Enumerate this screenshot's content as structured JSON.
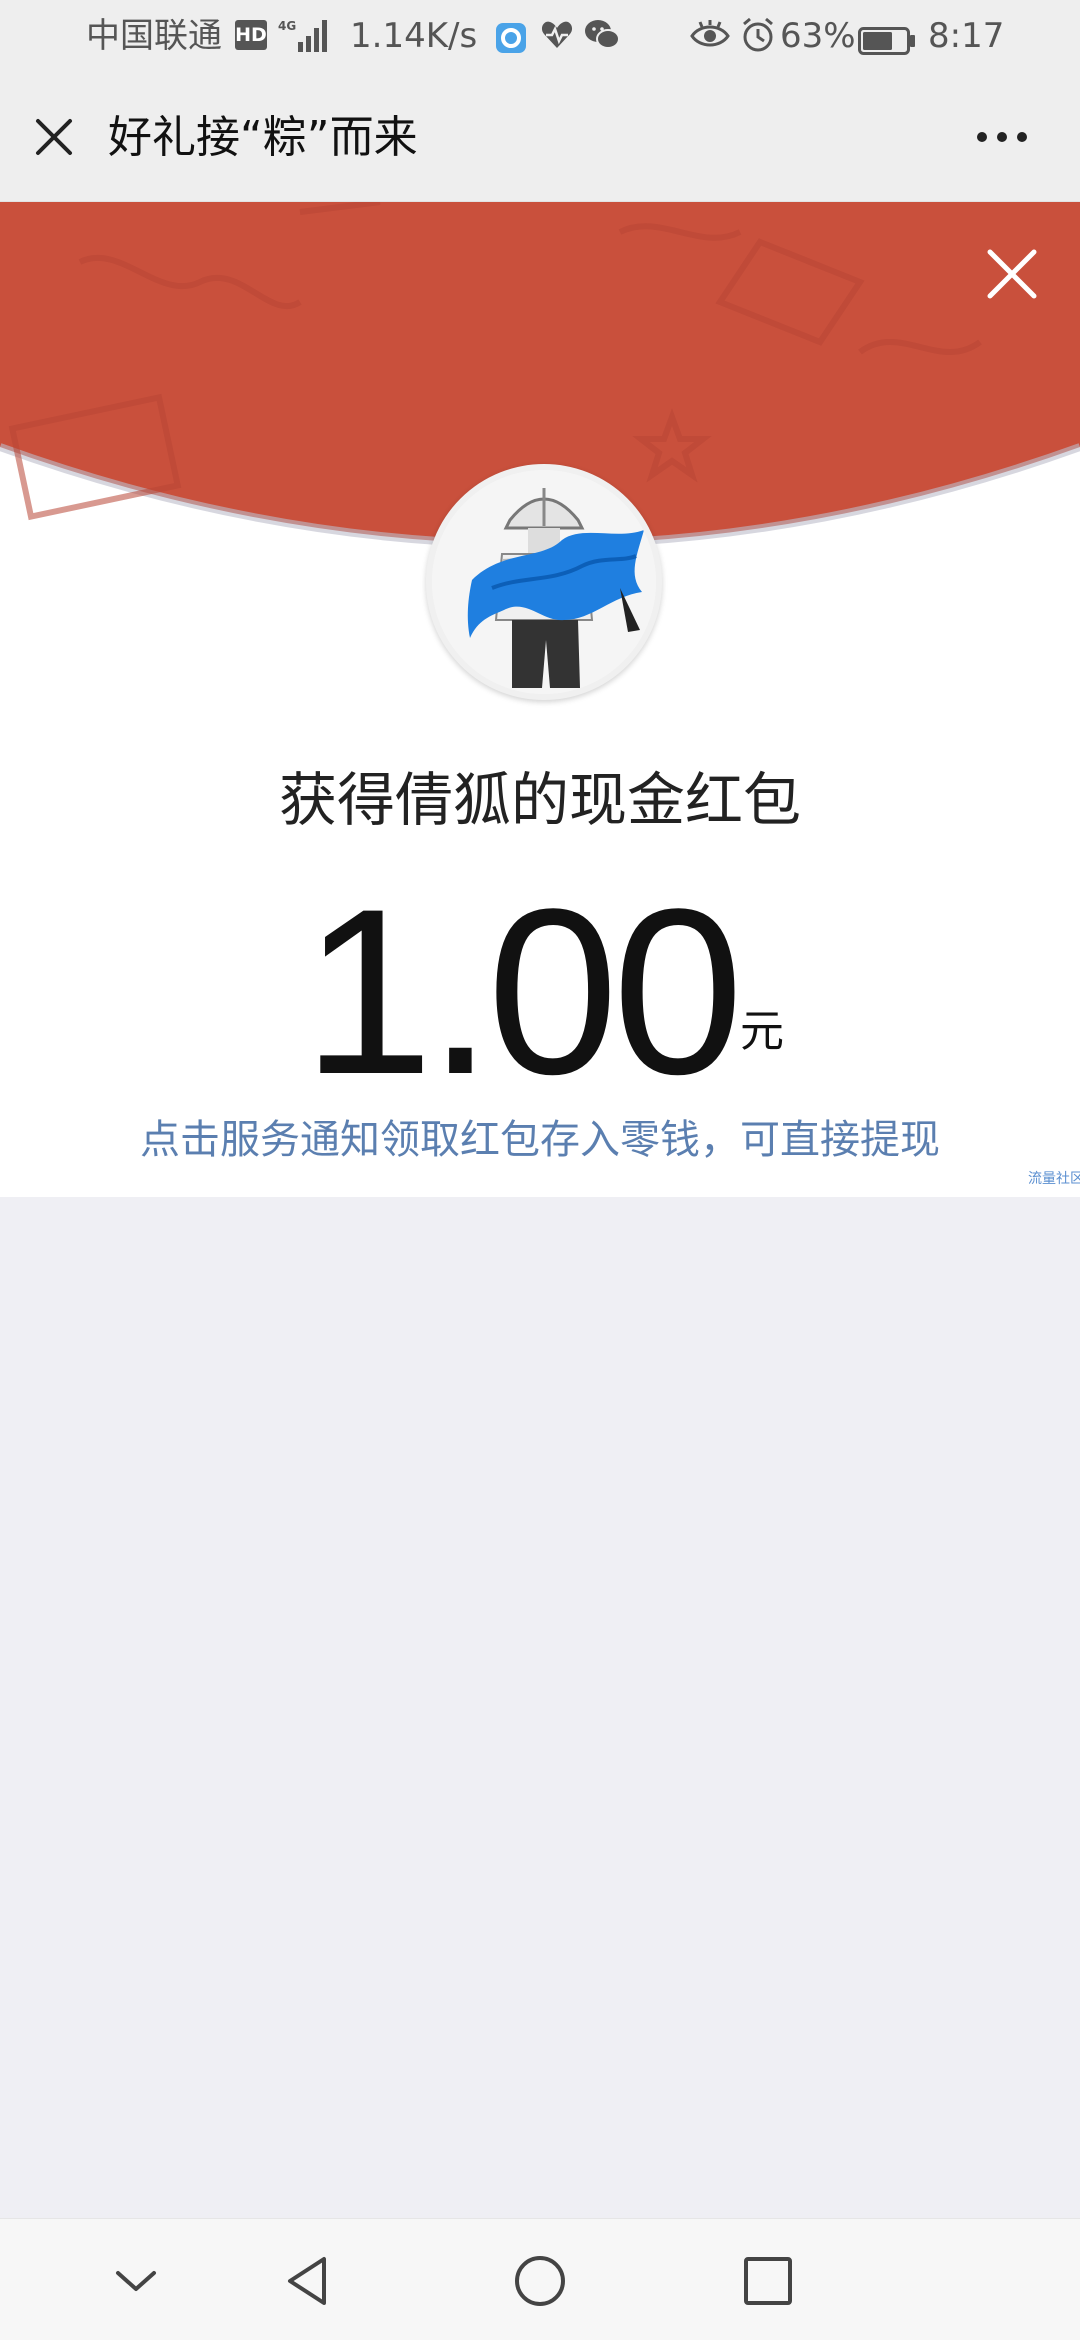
{
  "status_bar": {
    "carrier": "中国联通",
    "hd_badge": "HD",
    "network": "4G",
    "speed": "1.14K/s",
    "battery_percent": "63%",
    "time": "8:17",
    "icons": [
      "hd-icon",
      "signal-icon",
      "browser-app-icon",
      "heart-rate-icon",
      "wechat-icon",
      "eye-icon",
      "alarm-icon",
      "battery-icon"
    ]
  },
  "nav": {
    "title": "好礼接“粽”而来",
    "close_icon": "close-icon",
    "more_icon": "more-icon"
  },
  "red_packet": {
    "title": "获得倩狐的现金红包",
    "amount": "1.00",
    "unit": "元",
    "hint": "点击服务通知领取红包存入零钱，可直接提现",
    "watermark": "流量社区",
    "close_icon": "close-icon",
    "avatar": "avatar"
  },
  "system_nav": {
    "icons": [
      "chevron-down-icon",
      "back-icon",
      "home-icon",
      "recent-apps-icon"
    ]
  },
  "colors": {
    "banner_red": "#c9503c",
    "hint_blue": "#5b7fb0",
    "page_background": "#efeff4",
    "bar_background": "#eeeeee"
  }
}
